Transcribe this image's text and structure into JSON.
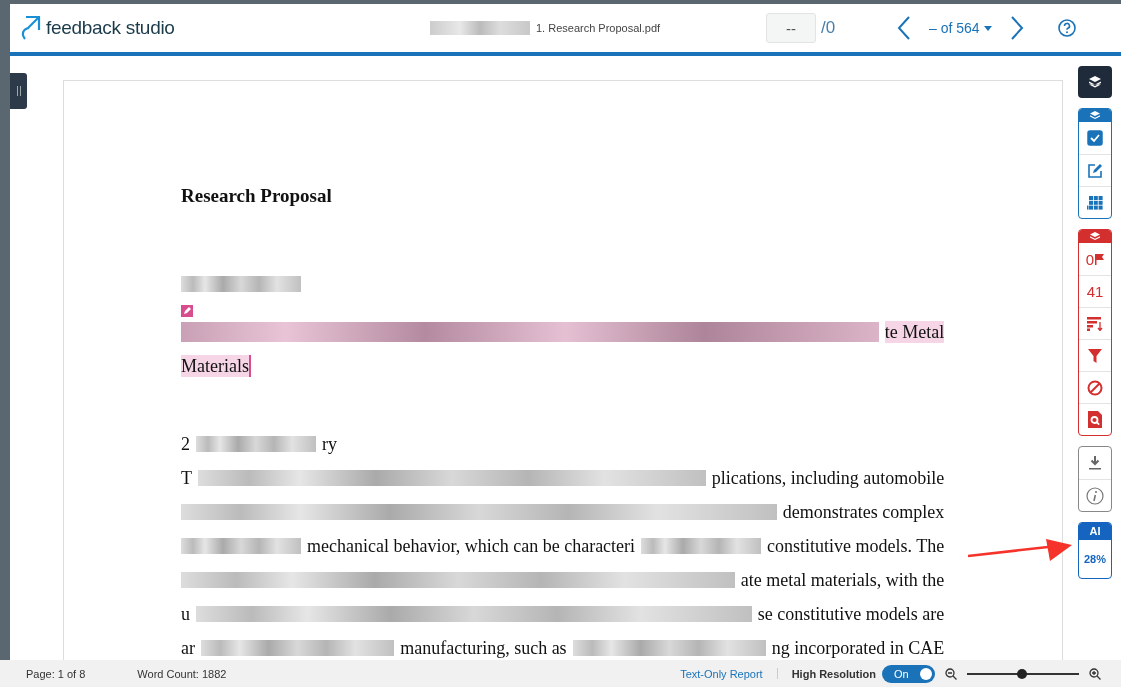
{
  "header": {
    "logo": "feedback studio",
    "file_name": "1. Research Proposal.pdf",
    "page_input": {
      "value": "--"
    },
    "page_total": "/0",
    "paper_position": "– of 564"
  },
  "document": {
    "title": "Research Proposal",
    "blocks": [
      {
        "kind": "short_line",
        "highlight": false,
        "segments": [
          {
            "kind": "redacted"
          }
        ]
      },
      {
        "kind": "marker"
      },
      {
        "kind": "line",
        "highlight": true,
        "segments": [
          {
            "kind": "redacted"
          },
          {
            "kind": "text",
            "text": "te Metal"
          }
        ]
      },
      {
        "kind": "short_line",
        "highlight": true,
        "segments": [
          {
            "kind": "text",
            "text": "Materials"
          }
        ]
      },
      {
        "kind": "gap"
      },
      {
        "kind": "short_line",
        "highlight": false,
        "segments": [
          {
            "kind": "text",
            "text": "2"
          },
          {
            "kind": "redacted"
          },
          {
            "kind": "text",
            "text": "ry"
          }
        ]
      },
      {
        "kind": "line",
        "highlight": false,
        "segments": [
          {
            "kind": "text",
            "text": "T"
          },
          {
            "kind": "redacted"
          },
          {
            "kind": "text",
            "text": "plications, including automobile"
          }
        ]
      },
      {
        "kind": "line",
        "highlight": false,
        "segments": [
          {
            "kind": "redacted"
          },
          {
            "kind": "text",
            "text": "demonstrates complex"
          }
        ]
      },
      {
        "kind": "line",
        "highlight": false,
        "segments": [
          {
            "kind": "redacted"
          },
          {
            "kind": "text",
            "text": "mechanical behavior, which can be characteri"
          },
          {
            "kind": "redacted"
          },
          {
            "kind": "text",
            "text": "constitutive models. The"
          }
        ]
      },
      {
        "kind": "line",
        "highlight": false,
        "segments": [
          {
            "kind": "redacted"
          },
          {
            "kind": "text",
            "text": "ate metal materials, with the"
          }
        ]
      },
      {
        "kind": "line",
        "highlight": false,
        "segments": [
          {
            "kind": "text",
            "text": "u"
          },
          {
            "kind": "redacted"
          },
          {
            "kind": "text",
            "text": "se constitutive models are"
          }
        ]
      },
      {
        "kind": "line",
        "highlight": false,
        "segments": [
          {
            "kind": "text",
            "text": "ar"
          },
          {
            "kind": "redacted"
          },
          {
            "kind": "text",
            "text": "manufacturing, such as"
          },
          {
            "kind": "redacted"
          },
          {
            "kind": "text",
            "text": "ng incorporated in CAE"
          }
        ]
      }
    ]
  },
  "toolbar": {
    "groups": [
      {
        "color": "#1f2a3a",
        "items": [
          {
            "kind": "layers"
          }
        ]
      },
      {
        "color": "#1a73b8",
        "items": [
          {
            "kind": "layers_tab"
          },
          {
            "kind": "checkbox",
            "checked": true
          },
          {
            "kind": "edit"
          },
          {
            "kind": "grid"
          }
        ]
      },
      {
        "color": "#d32f2f",
        "items": [
          {
            "kind": "layers_tab"
          },
          {
            "kind": "flag",
            "label": "0"
          },
          {
            "kind": "count",
            "label": "41"
          },
          {
            "kind": "sort"
          },
          {
            "kind": "filter"
          },
          {
            "kind": "ban"
          },
          {
            "kind": "doc-search"
          }
        ]
      },
      {
        "color": "#888888",
        "items": [
          {
            "kind": "download"
          },
          {
            "kind": "info"
          }
        ]
      },
      {
        "color": "#1565c0",
        "title": "AI",
        "items": [
          {
            "kind": "count",
            "label": "28%"
          }
        ]
      }
    ]
  },
  "status_bar": {
    "page": "Page: 1 of 8",
    "word_count": "Word Count: 1882",
    "text_only_link": "Text-Only Report",
    "high_resolution": {
      "label": "High Resolution",
      "toggle_text": "On",
      "on": true
    },
    "zoom": {
      "level": 0.49
    }
  }
}
